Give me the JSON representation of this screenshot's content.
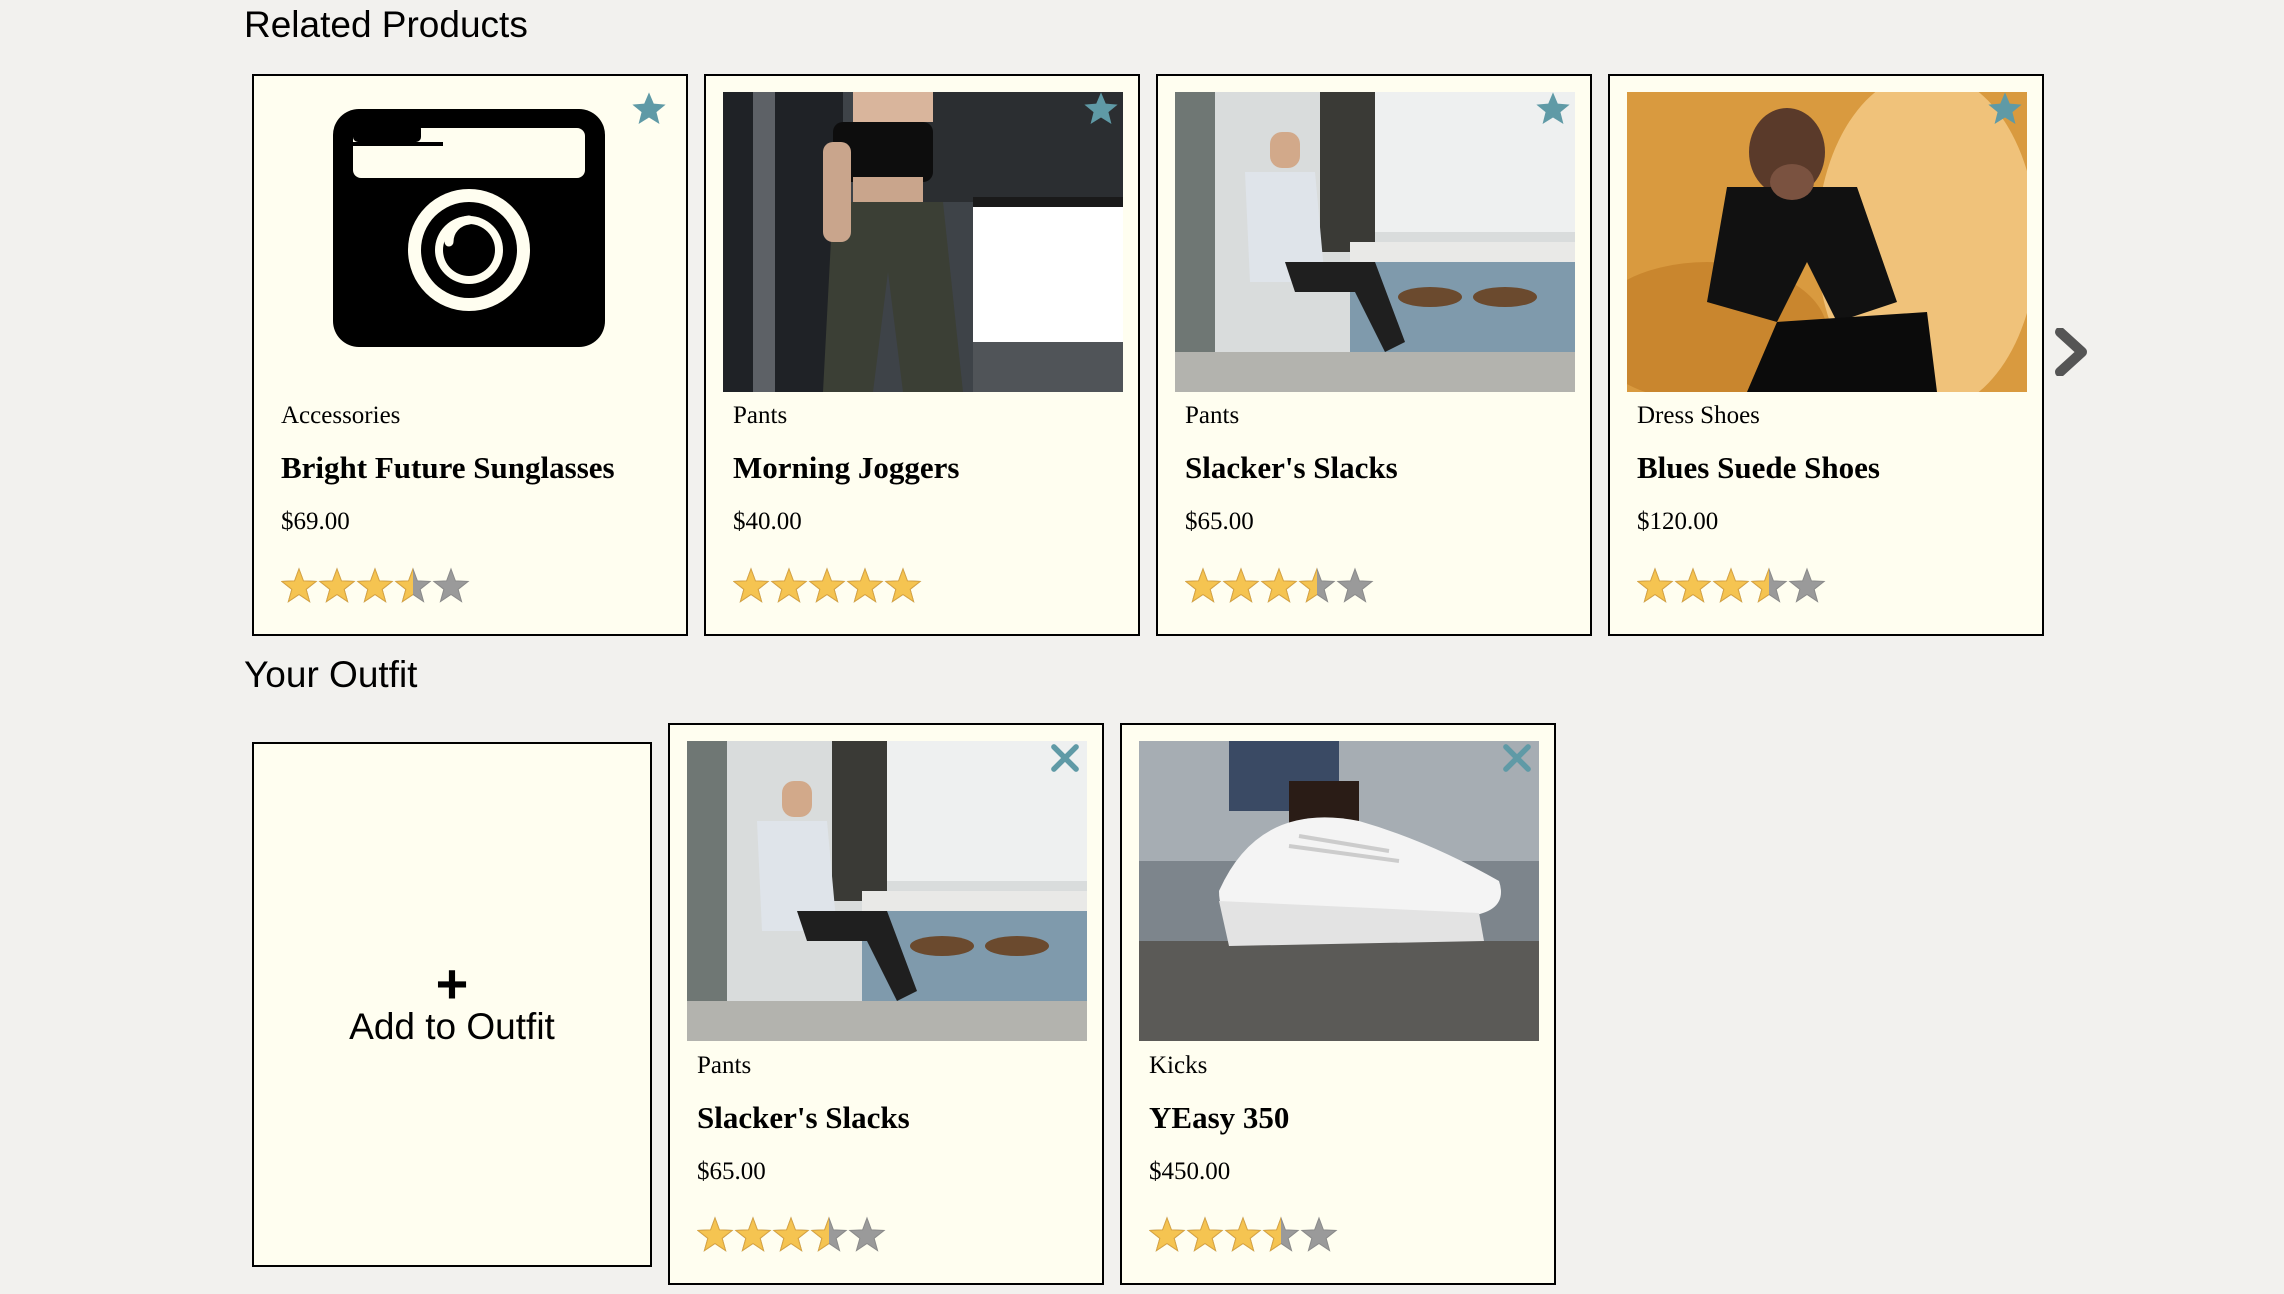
{
  "related": {
    "title": "Related Products",
    "cards": [
      {
        "category": "Accessories",
        "name": "Bright Future Sunglasses",
        "price": "$69.00",
        "rating": 3.5,
        "image": "camera-placeholder-icon"
      },
      {
        "category": "Pants",
        "name": "Morning Joggers",
        "price": "$40.00",
        "rating": 5,
        "image": "model-in-joggers-photo"
      },
      {
        "category": "Pants",
        "name": "Slacker's Slacks",
        "price": "$65.00",
        "rating": 3.5,
        "image": "man-in-cafe-photo"
      },
      {
        "category": "Dress Shoes",
        "name": "Blues Suede Shoes",
        "price": "$120.00",
        "rating": 3.5,
        "image": "man-on-fur-chair-photo"
      }
    ],
    "action_icon": "star-icon",
    "next_icon": "chevron-right-icon"
  },
  "outfit": {
    "title": "Your Outfit",
    "add_plus": "+",
    "add_label": "Add to Outfit",
    "cards": [
      {
        "category": "Pants",
        "name": "Slacker's Slacks",
        "price": "$65.00",
        "rating": 3.5,
        "image": "man-in-cafe-photo"
      },
      {
        "category": "Kicks",
        "name": "YEasy 350",
        "price": "$450.00",
        "rating": 3.5,
        "image": "white-sneaker-photo"
      }
    ],
    "action_icon": "close-icon"
  },
  "colors": {
    "background": "#f2f1ee",
    "card": "#fffef0",
    "accent": "#5f9aa6",
    "star_filled": "#f5c451",
    "star_empty": "#9a9a9a"
  }
}
